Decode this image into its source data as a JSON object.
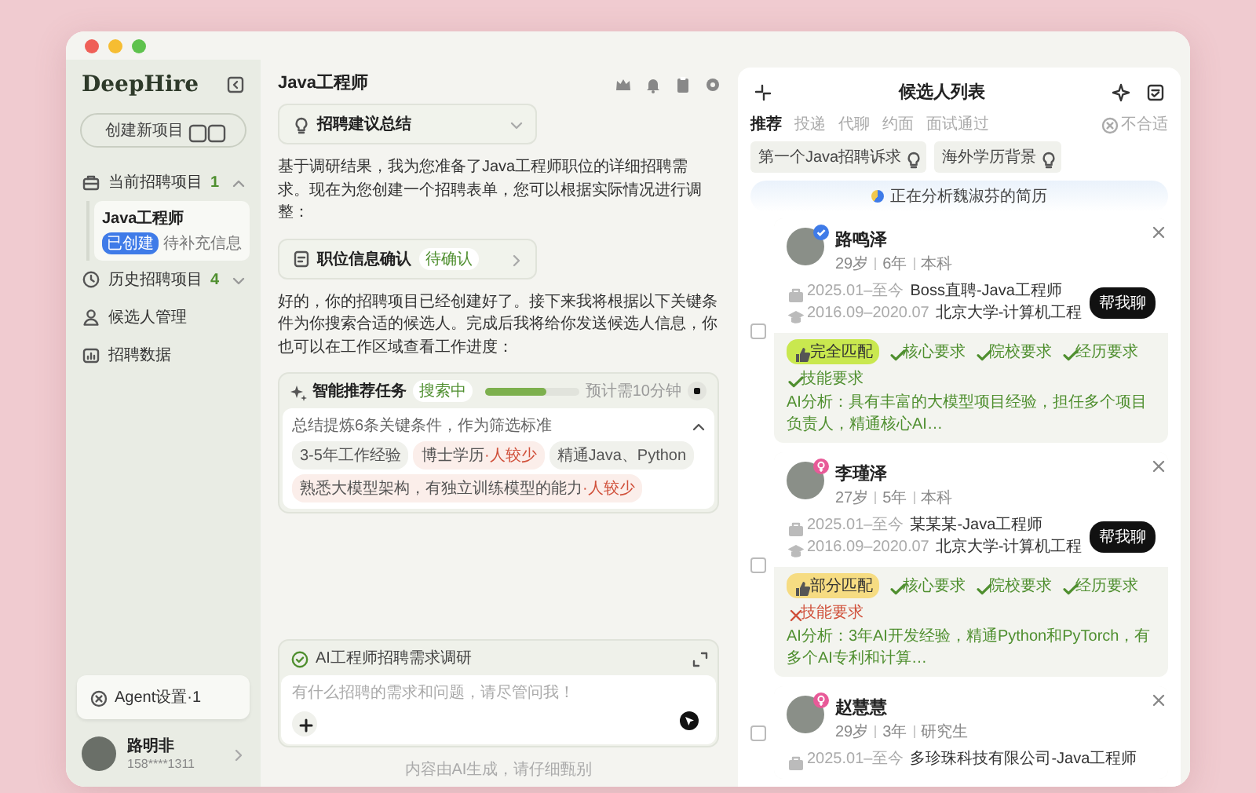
{
  "sidebar": {
    "logo": "DeepHire",
    "new_project": "创建新项目",
    "nav": [
      {
        "kind": "group",
        "label": "当前招聘项目",
        "count": "1",
        "expanded": true,
        "children": [
          {
            "title": "Java工程师",
            "badge": "已创建",
            "note": "待补充信息",
            "selected": true
          }
        ]
      },
      {
        "kind": "group",
        "label": "历史招聘项目",
        "count": "4",
        "expanded": false
      },
      {
        "kind": "link",
        "label": "候选人管理"
      },
      {
        "kind": "link",
        "label": "招聘数据"
      }
    ],
    "agent_settings": "Agent设置·1",
    "user": {
      "name": "路明非",
      "phone": "158****1311"
    }
  },
  "chat": {
    "title": "Java工程师",
    "messages": [
      {
        "kind": "dropdown",
        "label": "招聘建议总结",
        "expanded": false
      },
      {
        "kind": "text",
        "text": "基于调研结果，我为您准备了Java工程师职位的详细招聘需求。现在为您创建一个招聘表单，您可以根据实际情况进行调整："
      },
      {
        "kind": "confirm",
        "label": "职位信息确认",
        "status": "待确认"
      },
      {
        "kind": "text",
        "text": "好的，你的招聘项目已经创建好了。接下来我将根据以下关键条件为你搜索合适的候选人。完成后我将给你发送候选人信息，你也可以在工作区域查看工作进度："
      },
      {
        "kind": "task",
        "title": "智能推荐任务",
        "status": "搜索中",
        "level": 0.65,
        "eta": "预计需10分钟",
        "summary": "总结提炼6条关键条件，作为筛选标准",
        "expanded": true,
        "conditions": [
          {
            "label": "3-5年工作经验"
          },
          {
            "label": "博士学历",
            "warning": "·人较少"
          },
          {
            "label": "精通Java、Python"
          },
          {
            "label": "熟悉大模型架构，有独立训练模型的能力",
            "warning": "·人较少"
          }
        ]
      }
    ],
    "composer": {
      "task": "AI工程师招聘需求调研",
      "placeholder": "有什么招聘的需求和问题，请尽管问我！"
    },
    "disclaimer": "内容由AI生成，请仔细甄别"
  },
  "candidates_panel": {
    "title": "候选人列表",
    "tabs": [
      {
        "label": "推荐",
        "selected": true
      },
      {
        "label": "投递",
        "selected": false
      },
      {
        "label": "代聊",
        "selected": false
      },
      {
        "label": "约面",
        "selected": false
      },
      {
        "label": "面试通过",
        "selected": false
      }
    ],
    "reject": "不合适",
    "filters": [
      "第一个Java招聘诉求",
      "海外学历背景"
    ],
    "status_banner": "正在分析魏淑芬的简历",
    "candidates": [
      {
        "name": "路鸣泽",
        "avatar_badge": {
          "kind": "verified"
        },
        "age": "29岁",
        "years": "6年",
        "degree": "本科",
        "checked": false,
        "work_period": "2025.01–至今",
        "work": "Boss直聘-Java工程师",
        "edu_period": "2016.09–2020.07",
        "edu": "北京大学-计算机工程",
        "action": "帮我聊",
        "match": {
          "kind": "full",
          "label": "完全匹配"
        },
        "requirements": [
          {
            "label": "核心要求",
            "met": true
          },
          {
            "label": "院校要求",
            "met": true
          },
          {
            "label": "经历要求",
            "met": true
          },
          {
            "label": "技能要求",
            "met": true
          }
        ],
        "analysis": "AI分析：具有丰富的大模型项目经验，担任多个项目负责人，精通核心AI…"
      },
      {
        "name": "李瑾泽",
        "avatar_badge": {
          "kind": "female"
        },
        "age": "27岁",
        "years": "5年",
        "degree": "本科",
        "checked": false,
        "work_period": "2025.01–至今",
        "work": "某某某-Java工程师",
        "edu_period": "2016.09–2020.07",
        "edu": "北京大学-计算机工程",
        "action": "帮我聊",
        "match": {
          "kind": "partial",
          "label": "部分匹配"
        },
        "requirements": [
          {
            "label": "核心要求",
            "met": true
          },
          {
            "label": "院校要求",
            "met": true
          },
          {
            "label": "经历要求",
            "met": true
          },
          {
            "label": "技能要求",
            "met": false
          }
        ],
        "analysis": "AI分析：3年AI开发经验，精通Python和PyTorch，有多个AI专利和计算…"
      },
      {
        "name": "赵慧慧",
        "avatar_badge": {
          "kind": "female"
        },
        "age": "29岁",
        "years": "3年",
        "degree": "研究生",
        "checked": false,
        "work_period": "2025.01–至今",
        "work": "多珍珠科技有限公司-Java工程师"
      }
    ]
  }
}
